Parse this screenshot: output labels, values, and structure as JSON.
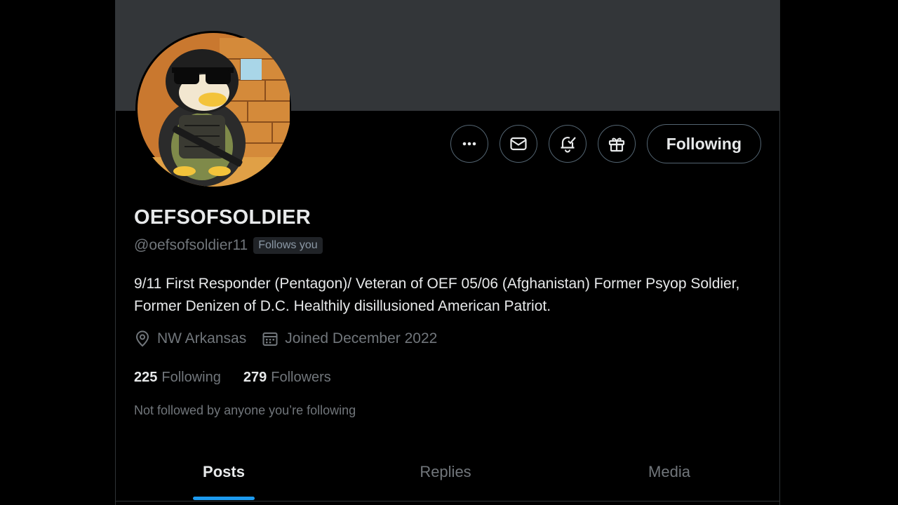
{
  "profile": {
    "display_name": "OEFSOFSOLDIER",
    "handle": "@oefsofsoldier11",
    "follows_you_badge": "Follows you",
    "bio": "9/11 First Responder (Pentagon)/ Veteran of OEF 05/06 (Afghanistan) Former Psyop Soldier, Former Denizen of D.C.  Healthily disillusioned American Patriot.",
    "location": "NW Arkansas",
    "joined": "Joined December 2022",
    "following_count": "225",
    "following_label": "Following",
    "followers_count": "279",
    "followers_label": "Followers",
    "not_followed_text": "Not followed by anyone you’re following"
  },
  "actions": {
    "more_icon": "more-horizontal-icon",
    "message_icon": "envelope-icon",
    "notify_icon": "bell-check-icon",
    "gift_icon": "gift-icon",
    "follow_button_label": "Following"
  },
  "tabs": [
    {
      "label": "Posts",
      "active": true
    },
    {
      "label": "Replies",
      "active": false
    },
    {
      "label": "Media",
      "active": false
    }
  ],
  "colors": {
    "background": "#000000",
    "banner": "#333639",
    "accent": "#1d9bf0",
    "secondary_text": "#71767b",
    "primary_text": "#e7e9ea"
  }
}
